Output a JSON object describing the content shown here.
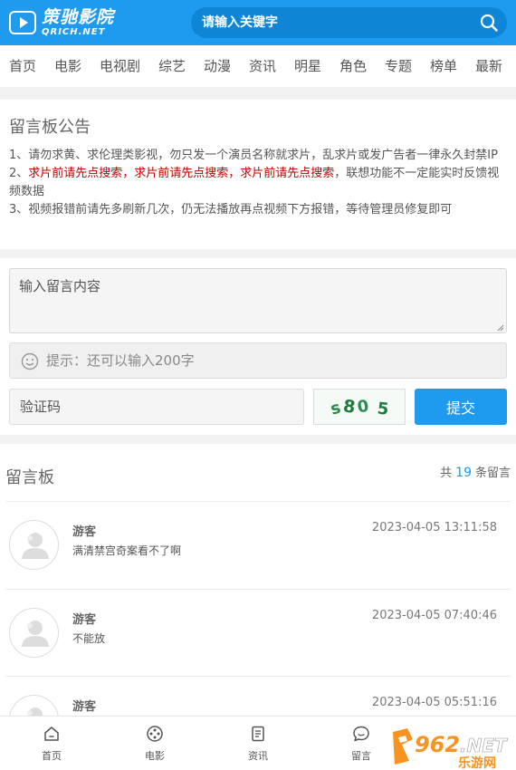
{
  "header": {
    "logo_name": "策驰影院",
    "logo_sub": "QRICH.NET",
    "search_placeholder": "请输入关键字"
  },
  "nav": [
    "首页",
    "电影",
    "电视剧",
    "综艺",
    "动漫",
    "资讯",
    "明星",
    "角色",
    "专题",
    "榜单",
    "最新"
  ],
  "notice": {
    "title": "留言板公告",
    "line1": "1、请勿求黄、求伦理类影视，勿只发一个演员名称就求片，乱求片或发广告者一律永久封禁IP",
    "line2_prefix": "2、",
    "line2_red": "求片前请先点搜索，求片前请先点搜索，求片前请先点搜索",
    "line2_suffix": "，联想功能不一定能实时反馈视频数据",
    "line3": "3、视频报错前请先多刷新几次，仍无法播放再点视频下方报错，等待管理员修复即可"
  },
  "form": {
    "content_placeholder": "输入留言内容",
    "tip": "提示：还可以输入200字",
    "captcha_placeholder": "验证码",
    "captcha_text": "s8 0 5",
    "submit_label": "提交"
  },
  "board": {
    "title": "留言板",
    "count_prefix": "共",
    "count": "19",
    "count_suffix": "条留言",
    "messages": [
      {
        "user": "游客",
        "time": "2023-04-05 13:11:58",
        "text": "满清禁宫奇案看不了啊"
      },
      {
        "user": "游客",
        "time": "2023-04-05 07:40:46",
        "text": "不能放"
      },
      {
        "user": "游客",
        "time": "2023-04-05 05:51:16",
        "text": ""
      }
    ]
  },
  "tabbar": [
    {
      "label": "首页",
      "icon": "home-icon"
    },
    {
      "label": "电影",
      "icon": "film-reel-icon"
    },
    {
      "label": "资讯",
      "icon": "news-icon"
    },
    {
      "label": "留言",
      "icon": "chat-bubble-icon"
    }
  ],
  "watermark": {
    "brand": "962.NET",
    "sub": "乐游网"
  },
  "colors": {
    "primary": "#1e9bef",
    "warning": "#c40000"
  }
}
